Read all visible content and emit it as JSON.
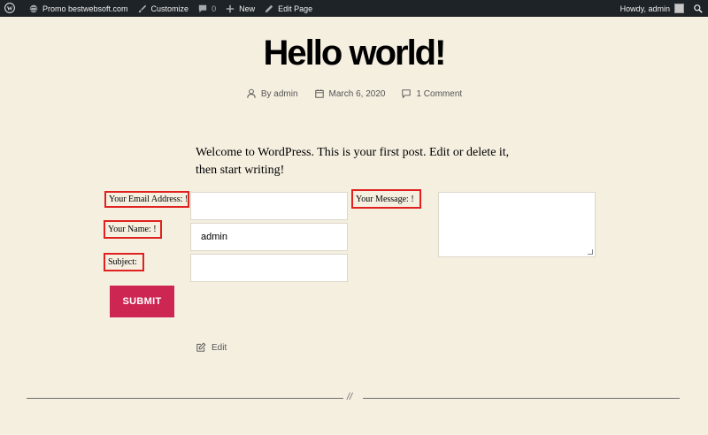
{
  "adminbar": {
    "wp_logo": "wordpress-logo",
    "site_name": "Promo bestwebsoft.com",
    "customize": "Customize",
    "comments_count": "0",
    "new_label": "New",
    "edit_page": "Edit Page",
    "howdy": "Howdy, admin"
  },
  "post": {
    "title": "Hello world!",
    "author": "By admin",
    "date": "March 6, 2020",
    "comments": "1 Comment",
    "intro": "Welcome to WordPress. This is your first post. Edit or delete it, then start writing!",
    "edit_label": "Edit"
  },
  "form": {
    "email_label": "Your Email Address: !",
    "name_label": "Your Name: !",
    "subject_label": "Subject:",
    "message_label": "Your Message: !",
    "email_value": "",
    "name_value": "admin",
    "subject_value": "",
    "message_value": "",
    "submit_label": "SUBMIT"
  },
  "separator": {
    "mark": "//"
  },
  "colors": {
    "admin_bar": "#1d2327",
    "background": "#f5efe0",
    "accent": "#cd2653",
    "label_border": "#e0211f"
  }
}
